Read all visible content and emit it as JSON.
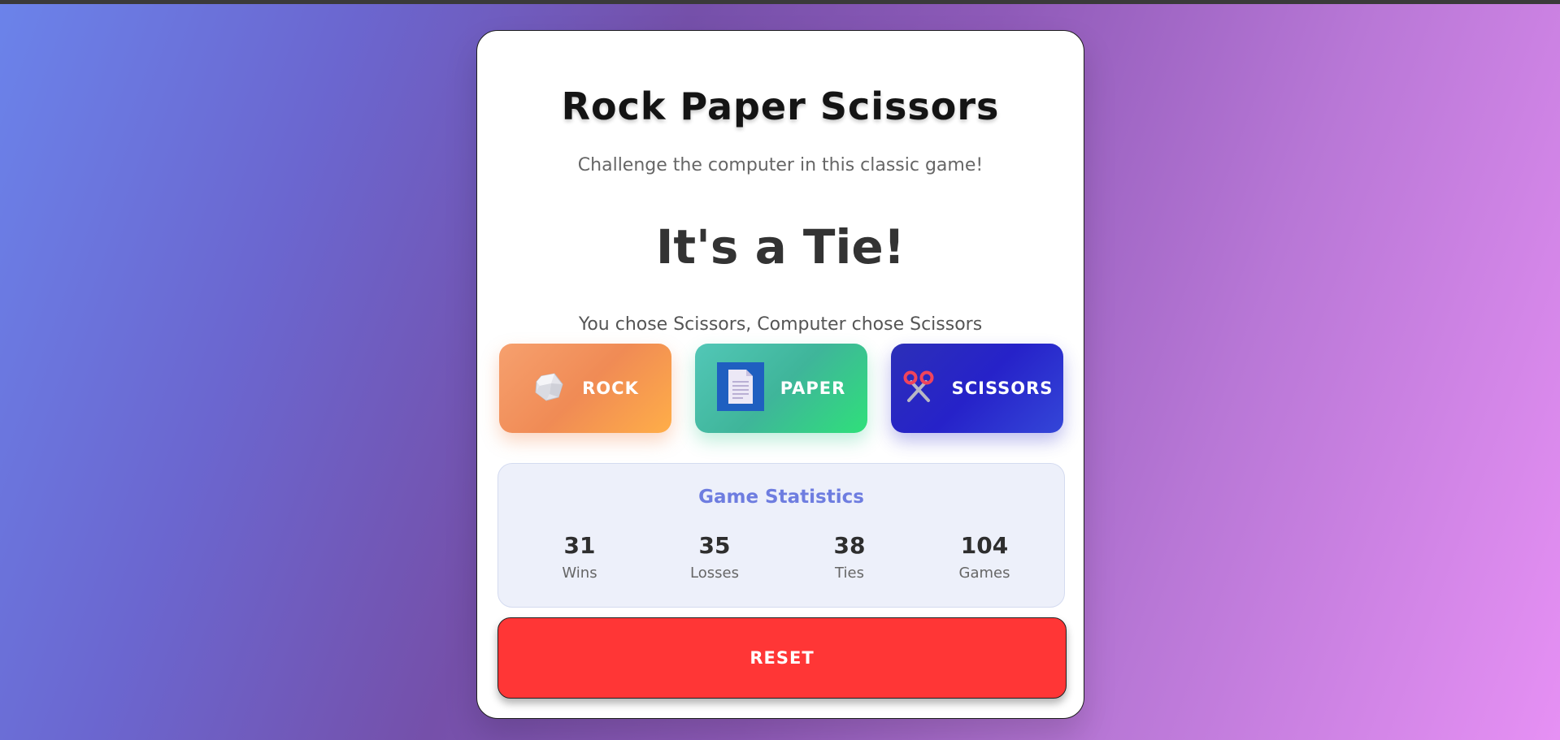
{
  "game": {
    "title": "Rock Paper Scissors",
    "subtitle": "Challenge the computer in this classic game!",
    "result": "It's a Tie!",
    "detail": "You chose Scissors, Computer chose Scissors"
  },
  "choices": [
    {
      "label": "ROCK",
      "icon": "rock-icon"
    },
    {
      "label": "PAPER",
      "icon": "paper-icon"
    },
    {
      "label": "SCISSORS",
      "icon": "scissors-icon"
    }
  ],
  "stats": {
    "title": "Game Statistics",
    "items": [
      {
        "value": "31",
        "label": "Wins"
      },
      {
        "value": "35",
        "label": "Losses"
      },
      {
        "value": "38",
        "label": "Ties"
      },
      {
        "value": "104",
        "label": "Games"
      }
    ]
  },
  "reset_label": "RESET",
  "colors": {
    "reset": "#ff3636",
    "stats_title": "#6e7de0",
    "rock": "#f08b55",
    "paper": "#2fe07a",
    "scissors": "#2622c9"
  }
}
